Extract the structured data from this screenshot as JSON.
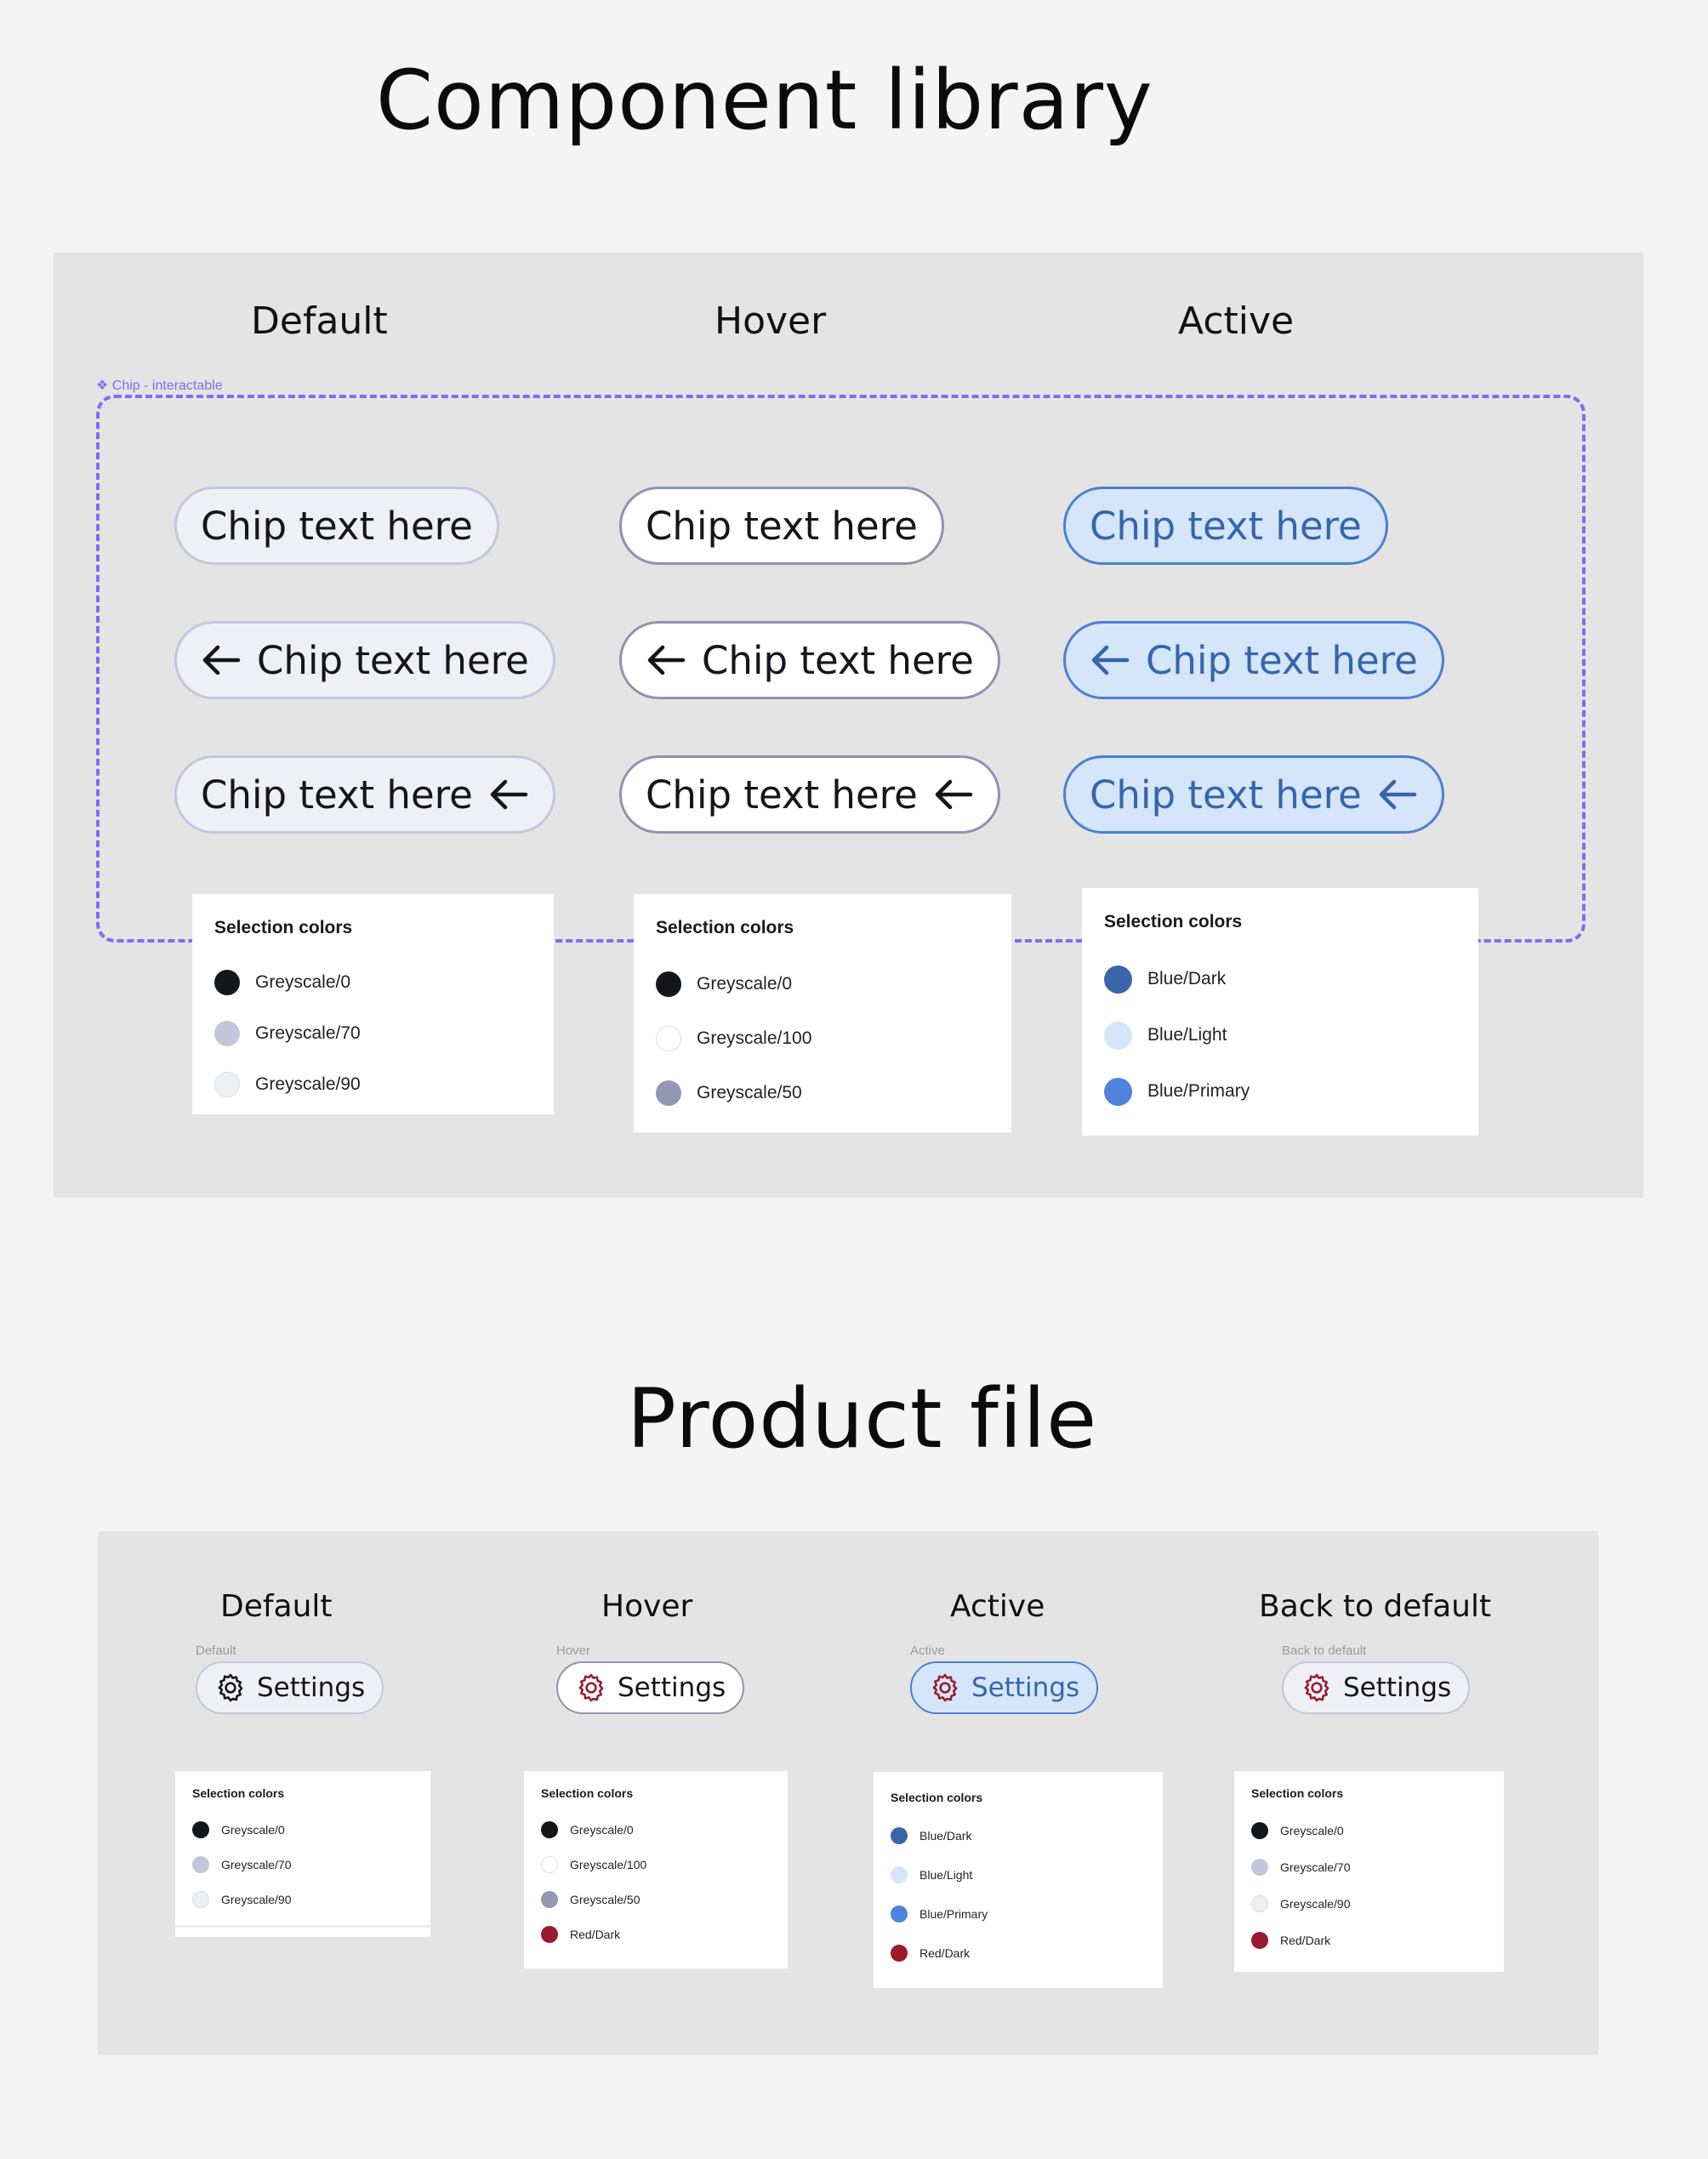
{
  "component_library": {
    "title": "Component library",
    "columns": [
      "Default",
      "Hover",
      "Active"
    ],
    "frame_label": "❖ Chip - interactable",
    "chip_text": "Chip text here",
    "chip_rows": [
      {
        "variant": "text-only"
      },
      {
        "variant": "leading-arrow",
        "icon": "arrow-left-icon"
      },
      {
        "variant": "trailing-arrow",
        "icon": "arrow-left-icon"
      }
    ],
    "selection_panels": [
      {
        "title": "Selection colors",
        "colors": [
          {
            "name": "Greyscale/0",
            "hex": "#14161c"
          },
          {
            "name": "Greyscale/70",
            "hex": "#c3c6dd"
          },
          {
            "name": "Greyscale/90",
            "hex": "#eef0f6"
          }
        ]
      },
      {
        "title": "Selection colors",
        "colors": [
          {
            "name": "Greyscale/0",
            "hex": "#14161c"
          },
          {
            "name": "Greyscale/100",
            "hex": "#ffffff"
          },
          {
            "name": "Greyscale/50",
            "hex": "#9598b2"
          }
        ]
      },
      {
        "title": "Selection colors",
        "colors": [
          {
            "name": "Blue/Dark",
            "hex": "#3b65aa"
          },
          {
            "name": "Blue/Light",
            "hex": "#d6e6fa"
          },
          {
            "name": "Blue/Primary",
            "hex": "#4f83de"
          }
        ]
      }
    ]
  },
  "product_file": {
    "title": "Product file",
    "columns": [
      {
        "heading": "Default",
        "label": "Default",
        "chip_text": "Settings",
        "icon": "gear-icon",
        "icon_color": "#14161c",
        "selection": {
          "title": "Selection colors",
          "colors": [
            {
              "name": "Greyscale/0",
              "hex": "#14161c"
            },
            {
              "name": "Greyscale/70",
              "hex": "#c3c6dd"
            },
            {
              "name": "Greyscale/90",
              "hex": "#eef0f6"
            }
          ]
        }
      },
      {
        "heading": "Hover",
        "label": "Hover",
        "chip_text": "Settings",
        "icon": "gear-icon",
        "icon_color": "#9b1a2c",
        "selection": {
          "title": "Selection colors",
          "colors": [
            {
              "name": "Greyscale/0",
              "hex": "#14161c"
            },
            {
              "name": "Greyscale/100",
              "hex": "#ffffff"
            },
            {
              "name": "Greyscale/50",
              "hex": "#9598b2"
            },
            {
              "name": "Red/Dark",
              "hex": "#9b1a2c"
            }
          ]
        }
      },
      {
        "heading": "Active",
        "label": "Active",
        "chip_text": "Settings",
        "icon": "gear-icon",
        "icon_color": "#9b1a2c",
        "selection": {
          "title": "Selection colors",
          "colors": [
            {
              "name": "Blue/Dark",
              "hex": "#3b65aa"
            },
            {
              "name": "Blue/Light",
              "hex": "#d6e6fa"
            },
            {
              "name": "Blue/Primary",
              "hex": "#4f83de"
            },
            {
              "name": "Red/Dark",
              "hex": "#9b1a2c"
            }
          ]
        }
      },
      {
        "heading": "Back to default",
        "label": "Back to default",
        "chip_text": "Settings",
        "icon": "gear-icon",
        "icon_color": "#9b1a2c",
        "selection": {
          "title": "Selection colors",
          "colors": [
            {
              "name": "Greyscale/0",
              "hex": "#14161c"
            },
            {
              "name": "Greyscale/70",
              "hex": "#c3c6dd"
            },
            {
              "name": "Greyscale/90",
              "hex": "#eef0f6"
            },
            {
              "name": "Red/Dark",
              "hex": "#9b1a2c"
            }
          ]
        }
      }
    ]
  },
  "colors": {
    "page_bg": "#f4f4f4",
    "panel_bg": "#e4e4e4",
    "frame_dash": "#7b6ff2",
    "active_text": "#3565ad",
    "active_border": "#4a7fd6"
  }
}
